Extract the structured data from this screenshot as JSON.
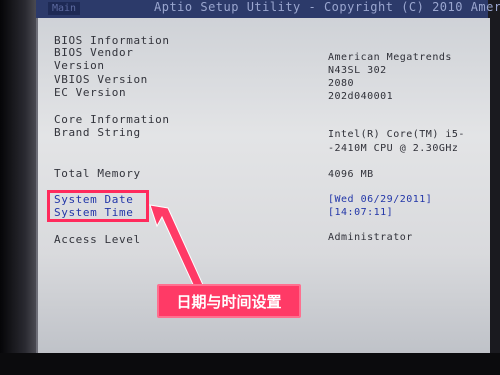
{
  "header": {
    "tab_label": "Main",
    "title": "Aptio Setup Utility - Copyright (C) 2010 Americ"
  },
  "bios_info": {
    "section": "BIOS Information",
    "vendor_label": "BIOS Vendor",
    "vendor_value": "American Megatrends",
    "version_label": "Version",
    "version_value": "N43SL 302",
    "vbios_label": "VBIOS Version",
    "vbios_value": "2080",
    "ec_label": "EC Version",
    "ec_value": "202d040001"
  },
  "core_info": {
    "section": "Core Information",
    "brand_label": "Brand String",
    "brand_value_line1": "Intel(R) Core(TM) i5-",
    "brand_value_line2": "-2410M CPU @ 2.30GHz"
  },
  "memory": {
    "label": "Total Memory",
    "value": "4096 MB"
  },
  "datetime": {
    "date_label": "System Date",
    "date_value": "[Wed 06/29/2011]",
    "time_label": "System Time",
    "time_value": "[14:07:11]"
  },
  "access": {
    "label": "Access Level",
    "value": "Administrator"
  },
  "annotation": {
    "text": "日期与时间设置",
    "color": "#ff3a66"
  }
}
